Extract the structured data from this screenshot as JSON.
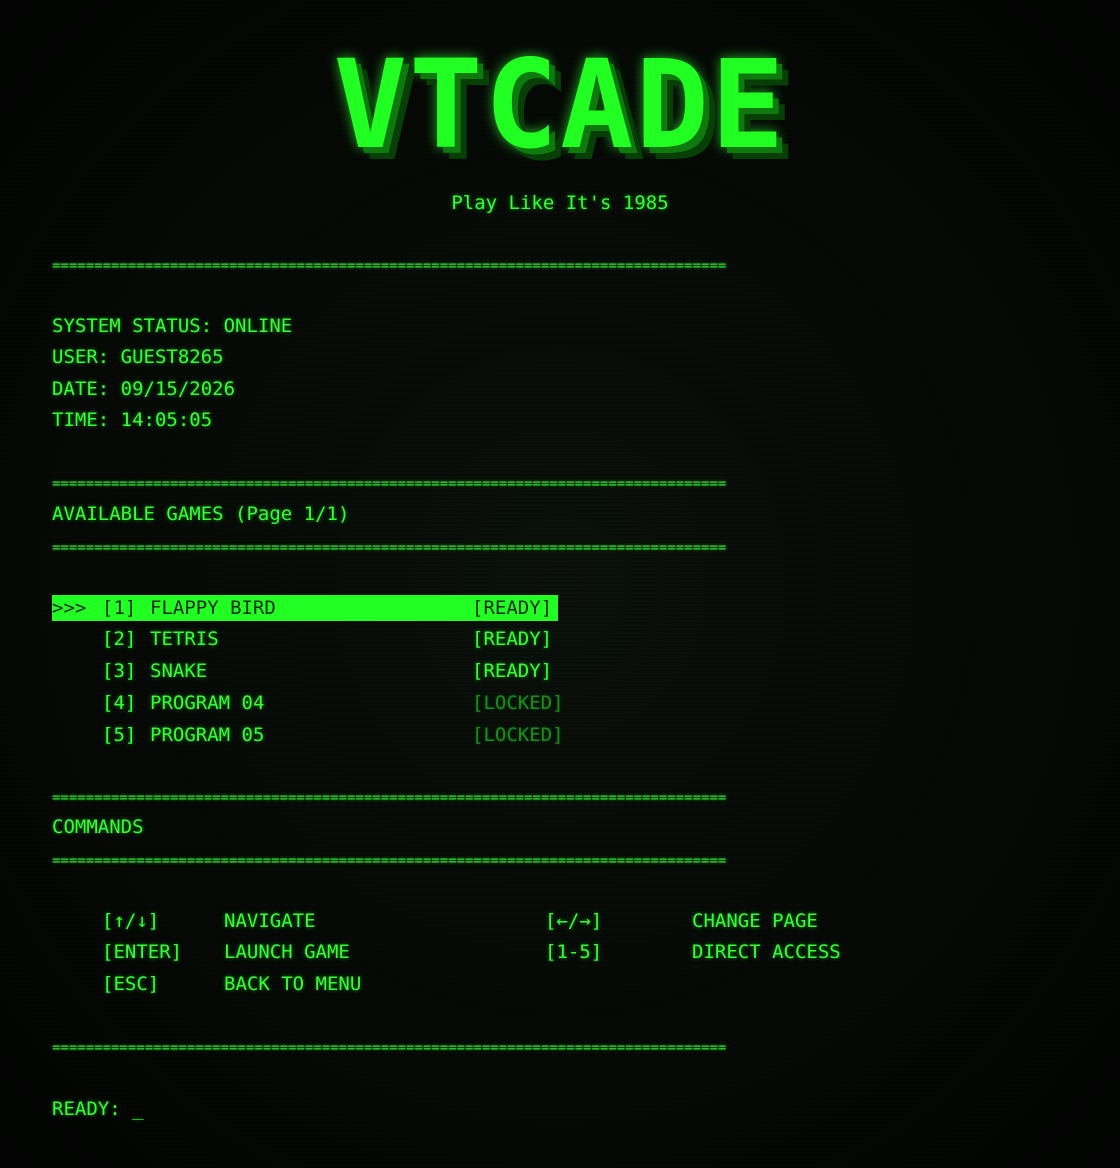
{
  "header": {
    "logo": "VTCADE",
    "tagline": "Play Like It's 1985"
  },
  "divider": "================================================================================",
  "system": {
    "status": "SYSTEM STATUS: ONLINE",
    "user": "USER: GUEST8265",
    "date": "DATE: 09/15/2026",
    "time": "TIME: 14:05:05"
  },
  "games_section": {
    "title": "AVAILABLE GAMES (Page 1/1)",
    "selector": ">>>",
    "items": [
      {
        "num": "[1]",
        "name": "FLAPPY BIRD",
        "status": "[READY]",
        "locked": false
      },
      {
        "num": "[2]",
        "name": "TETRIS",
        "status": "[READY]",
        "locked": false
      },
      {
        "num": "[3]",
        "name": "SNAKE",
        "status": "[READY]",
        "locked": false
      },
      {
        "num": "[4]",
        "name": "PROGRAM 04",
        "status": "[LOCKED]",
        "locked": true
      },
      {
        "num": "[5]",
        "name": "PROGRAM 05",
        "status": "[LOCKED]",
        "locked": true
      }
    ]
  },
  "commands_section": {
    "title": "COMMANDS",
    "items": [
      {
        "key": "[↑/↓]",
        "action": "NAVIGATE"
      },
      {
        "key": "[ENTER]",
        "action": "LAUNCH GAME"
      },
      {
        "key": "[ESC]",
        "action": "BACK TO MENU"
      },
      {
        "key": "[←/→]",
        "action": "CHANGE PAGE"
      },
      {
        "key": "[1-5]",
        "action": "DIRECT ACCESS"
      }
    ]
  },
  "prompt": {
    "label": "READY:",
    "cursor": "_"
  },
  "colors": {
    "phosphor": "#33ff33",
    "highlight": "#22ff22",
    "locked": "#1d8a1d",
    "background": "#050805"
  }
}
